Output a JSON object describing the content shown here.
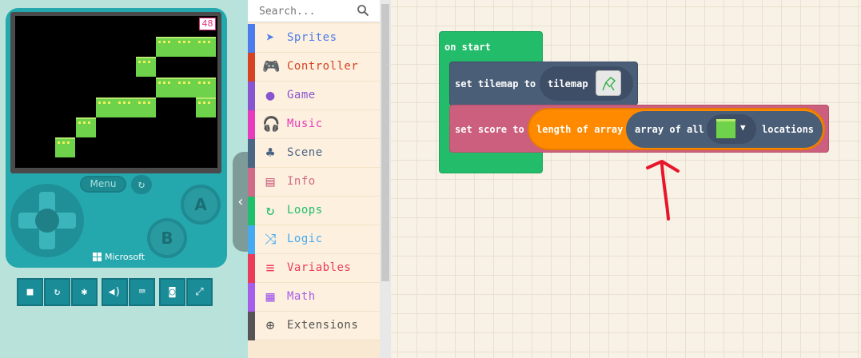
{
  "simulator": {
    "score": "48",
    "menu_label": "Menu",
    "brand": "Microsoft",
    "a_label": "A",
    "b_label": "B",
    "toolbar": [
      "stop-icon",
      "restart-icon",
      "debug-icon",
      "sound-icon",
      "keyboard-icon",
      "screenshot-icon",
      "fullscreen-icon"
    ]
  },
  "toolbox": {
    "search_placeholder": "Search...",
    "categories": [
      {
        "label": "Sprites",
        "color": "#4b7bec",
        "icon": "paper-plane-icon"
      },
      {
        "label": "Controller",
        "color": "#d54322",
        "icon": "gamepad-icon"
      },
      {
        "label": "Game",
        "color": "#8854d0",
        "icon": "circle-icon"
      },
      {
        "label": "Music",
        "color": "#e63bba",
        "icon": "headphones-icon"
      },
      {
        "label": "Scene",
        "color": "#4b6584",
        "icon": "tree-icon"
      },
      {
        "label": "Info",
        "color": "#cf6a87",
        "icon": "id-card-icon"
      },
      {
        "label": "Loops",
        "color": "#20bf6b",
        "icon": "loop-icon"
      },
      {
        "label": "Logic",
        "color": "#45aaf2",
        "icon": "shuffle-icon"
      },
      {
        "label": "Variables",
        "color": "#eb3b5a",
        "icon": "list-icon"
      },
      {
        "label": "Math",
        "color": "#a55eea",
        "icon": "calculator-icon"
      },
      {
        "label": "Extensions",
        "color": "#555555",
        "icon": "plus-circle-icon"
      }
    ]
  },
  "workspace": {
    "on_start": "on start",
    "set_tilemap": "set tilemap to",
    "tilemap": "tilemap",
    "set_score": "set score to",
    "length_of_array": "length of array",
    "array_of_all": "array of all",
    "locations": "locations"
  }
}
